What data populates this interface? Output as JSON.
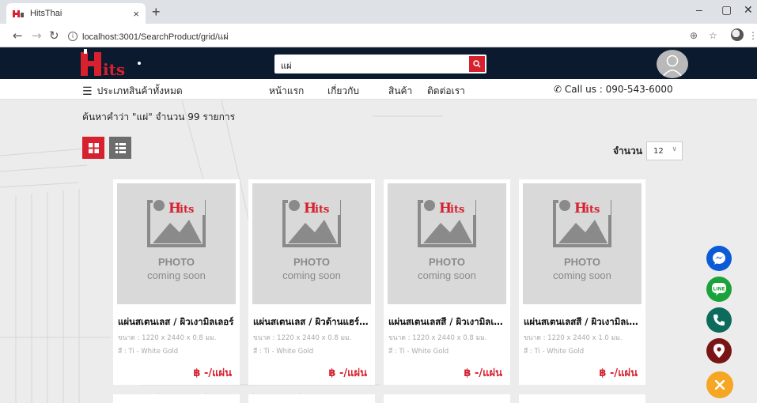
{
  "browser": {
    "tab_title": "HitsThai",
    "tab_close": "×",
    "new_tab": "+",
    "url": "localhost:3001/SearchProduct/grid/แผ่",
    "minimize": "–",
    "maximize": "▢",
    "close": "✕"
  },
  "header": {
    "search_value": "แผ่"
  },
  "nav": {
    "categories": "ประเภทสินค้าทั้งหมด",
    "home": "หน้าแรก",
    "about": "เกี่ยวกับ",
    "products": "สินค้า",
    "contact": "ติดต่อเรา",
    "call": "Call us : 090-543-6000"
  },
  "main": {
    "heading": "ค้นหาคำว่า \"แผ่\" จำนวน 99 รายการ",
    "count_label": "จำนวน",
    "count_value": "12"
  },
  "placeholder": {
    "line1": "PHOTO",
    "line2": "coming soon"
  },
  "products": [
    {
      "name": "แผ่นสเตนเลส / ผิวเงามิลเลอร์",
      "spec": "ขนาด : 1220 x 2440 x 0.8 มม.",
      "color": "สี : Ti - White Gold",
      "price": "฿ -/แผ่น"
    },
    {
      "name": "แผ่นสเตนเลส / ผิวด้านแฮร์ไลน์",
      "spec": "ขนาด : 1220 x 2440 x 0.8 มม.",
      "color": "สี : Ti - White Gold",
      "price": "฿ -/แผ่น"
    },
    {
      "name": "แผ่นสเตนเลสสี / ผิวเงามิลเลอร์",
      "spec": "ขนาด : 1220 x 2440 x 0.8 มม.",
      "color": "สี : Ti - White Gold",
      "price": "฿ -/แผ่น"
    },
    {
      "name": "แผ่นสเตนเลสสี / ผิวเงามิลเลอร์",
      "spec": "ขนาด : 1220 x 2440 x 1.0 มม.",
      "color": "สี : Ti - White Gold",
      "price": "฿ -/แผ่น"
    }
  ],
  "colors": {
    "brand_red": "#d7212f",
    "header_navy": "#0b1a2e",
    "grid_view_active": "#d7212f",
    "list_view": "#6d6d6d",
    "messenger": "#0a5bd6",
    "line": "#1aa33a",
    "phone": "#0c6b5a",
    "location": "#7a1515",
    "toggle": "#f5a623"
  },
  "icons": {
    "messenger": "messenger-icon",
    "line": "line-icon",
    "phone": "phone-icon",
    "location": "location-pin-icon",
    "toggle": "close-icon"
  }
}
